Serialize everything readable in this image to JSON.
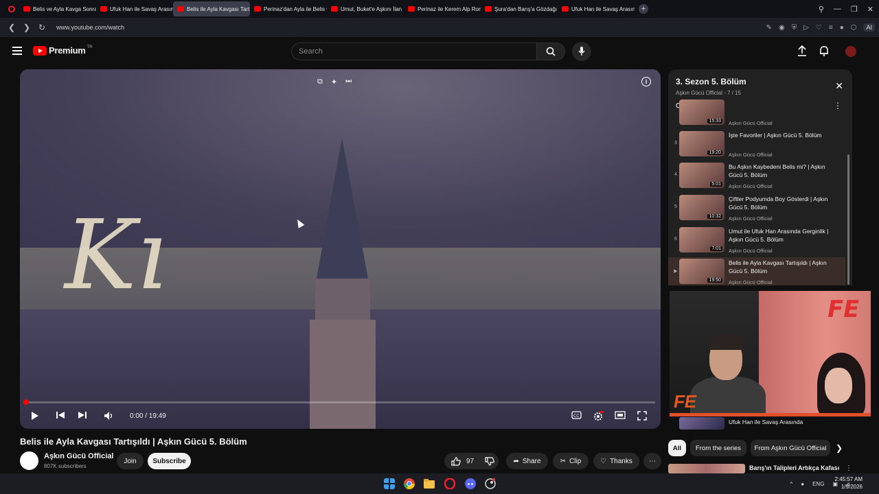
{
  "browser": {
    "tabs": [
      {
        "label": "Belis ve Ayla Kavga Sonra"
      },
      {
        "label": "Ufuk Han ile Savaş Arasında"
      },
      {
        "label": "Belis ile Ayla Kavgası Tartı"
      },
      {
        "label": "Perinaz'dan Ayla ile Belis G"
      },
      {
        "label": "Umut, Buket'e Aşkını İlan E"
      },
      {
        "label": "Perinaz ile Kerem Alp Rom"
      },
      {
        "label": "Şura'dan Barış'a Gözdağı |"
      },
      {
        "label": "Ufuk Han ile Savaş Arasında"
      }
    ],
    "active_tab_index": 2,
    "url": "www.youtube.com/watch",
    "ai_label": "AI"
  },
  "header": {
    "logo_text": "Premium",
    "region": "TR",
    "search_placeholder": "Search"
  },
  "player": {
    "time": "0:00 / 19:49",
    "progress_fraction": 0.005,
    "overlay_script": "Kı"
  },
  "video": {
    "title": "Belis ile Ayla Kavgası Tartışıldı | Aşkın Gücü 5. Bölüm",
    "channel": "Aşkın Gücü Official",
    "subscribers": "807K subscribers",
    "join_label": "Join",
    "subscribe_label": "Subscribe",
    "likes": "97",
    "share_label": "Share",
    "clip_label": "Clip",
    "thanks_label": "Thanks"
  },
  "playlist": {
    "title": "3. Sezon 5. Bölüm",
    "subtitle": "Aşkın Gücü Official - 7 / 15",
    "partial_top": {
      "duration": "15:33",
      "channel": "Aşkın Gücü Official"
    },
    "items": [
      {
        "index": "3",
        "title": "İşte Favoriler | Aşkın Gücü 5. Bölüm",
        "channel": "Aşkın Gücü Official",
        "duration": "19:20"
      },
      {
        "index": "4",
        "title": "Bu Aşkın Kaybedeni Belis mi? | Aşkın Gücü 5. Bölüm",
        "channel": "Aşkın Gücü Official",
        "duration": "5:01"
      },
      {
        "index": "5",
        "title": "Çiftler Podyumda Boy Gösterdi | Aşkın Gücü 5. Bölüm",
        "channel": "Aşkın Gücü Official",
        "duration": "10:32"
      },
      {
        "index": "6",
        "title": "Umut ile Ufuk Han Arasında Gerginlik | Aşkın Gücü 5. Bölüm",
        "channel": "Aşkın Gücü Official",
        "duration": "7:01"
      },
      {
        "index": "▶",
        "title": "Belis ile Ayla Kavgası Tartışıldı | Aşkın Gücü 5. Bölüm",
        "channel": "Aşkın Gücü Official",
        "duration": "19:50"
      }
    ],
    "next_item_title": "Ufuk Han ile Savaş Arasında"
  },
  "chips": {
    "all": "All",
    "series": "From the series",
    "channel": "From Aşkın Gücü Official"
  },
  "recommendation": {
    "title": "Barış'ın Talipleri Artıkça Kafası"
  },
  "taskbar": {
    "lang": "ENG",
    "time": "2:45:57 AM",
    "date": "1/9/2026"
  },
  "colors": {
    "accent": "#ff0000",
    "background": "#0f0f0f",
    "active_playlist_bg": "#3a2c28"
  }
}
